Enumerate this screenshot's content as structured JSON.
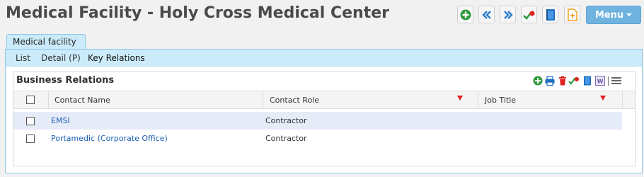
{
  "page": {
    "title": "Medical Facility - Holy Cross Medical Center"
  },
  "toolbar": {
    "icons": [
      "add-icon",
      "previous-icon",
      "next-icon",
      "key-relation-icon",
      "notebook-icon",
      "document-icon"
    ],
    "menu_label": "Menu"
  },
  "tab": {
    "label": "Medical facility"
  },
  "subnav": {
    "list_label": "List",
    "detail_label": "Detail (P)",
    "key_relations_label": "Key Relations"
  },
  "section": {
    "title": "Business Relations",
    "tools": [
      "add-icon",
      "print-icon",
      "delete-icon",
      "link-icon",
      "notebook-icon",
      "word-icon",
      "menu-icon"
    ]
  },
  "grid": {
    "headers": {
      "contact_name": "Contact Name",
      "contact_role": "Contact Role",
      "job_title": "Job Title"
    },
    "rows": [
      {
        "contact_name": "EMSI",
        "contact_role": "Contractor",
        "job_title": ""
      },
      {
        "contact_name": "Portamedic (Corporate Office)",
        "contact_role": "Contractor",
        "job_title": ""
      }
    ]
  },
  "colors": {
    "accent_blue": "#6fb4e0",
    "tab_bg": "#ccebfa",
    "link": "#1a5fb4",
    "selected_row": "#e6ebf8",
    "filter_red": "#e02020"
  }
}
